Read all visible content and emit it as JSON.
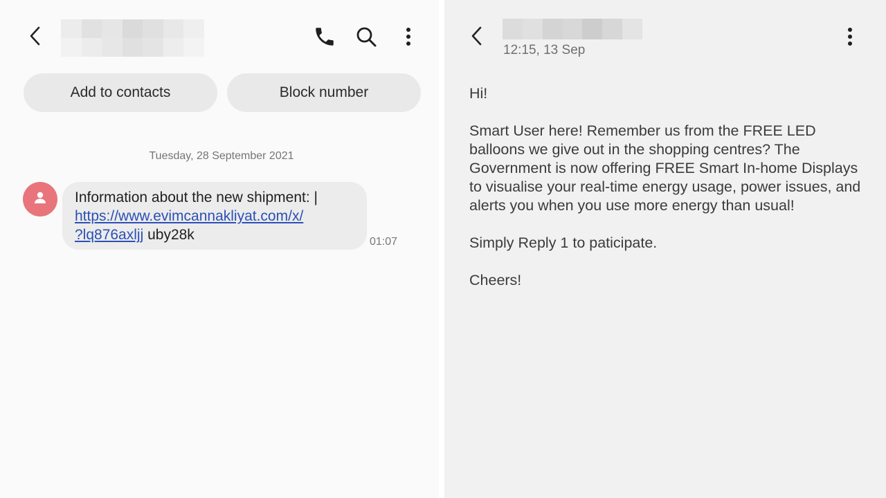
{
  "left": {
    "actions": {
      "add_contacts": "Add to contacts",
      "block_number": "Block number"
    },
    "date_separator": "Tuesday, 28 September 2021",
    "message": {
      "text_before_link": "Information about the new shipment: |",
      "link_line1": "https://www.evimcannakliyat.com/x/",
      "link_line2": "?lq876axljj",
      "text_after_link": " uby28k",
      "time": "01:07"
    },
    "icons": {
      "back": "back-arrow-icon",
      "call": "phone-icon",
      "search": "search-icon",
      "more": "more-vertical-icon",
      "avatar": "person-icon"
    }
  },
  "right": {
    "timestamp": "12:15, 13 Sep",
    "message_paragraphs": [
      "Hi!",
      "Smart User here! Remember us from the FREE LED balloons we give out in the shopping centres? The Government is now offering FREE Smart In-home Displays to visualise your real-time energy usage, power issues, and alerts you when you use more energy than usual!",
      "Simply Reply 1 to paticipate.",
      "Cheers!"
    ],
    "icons": {
      "back": "back-arrow-icon",
      "more": "more-vertical-icon"
    }
  },
  "colors": {
    "avatar": "#e8757b",
    "link": "#2a4fb6",
    "pill": "#e9e9e9",
    "bubble": "#ececec",
    "left_bg": "#fafafa",
    "right_bg": "#f1f1f1"
  }
}
